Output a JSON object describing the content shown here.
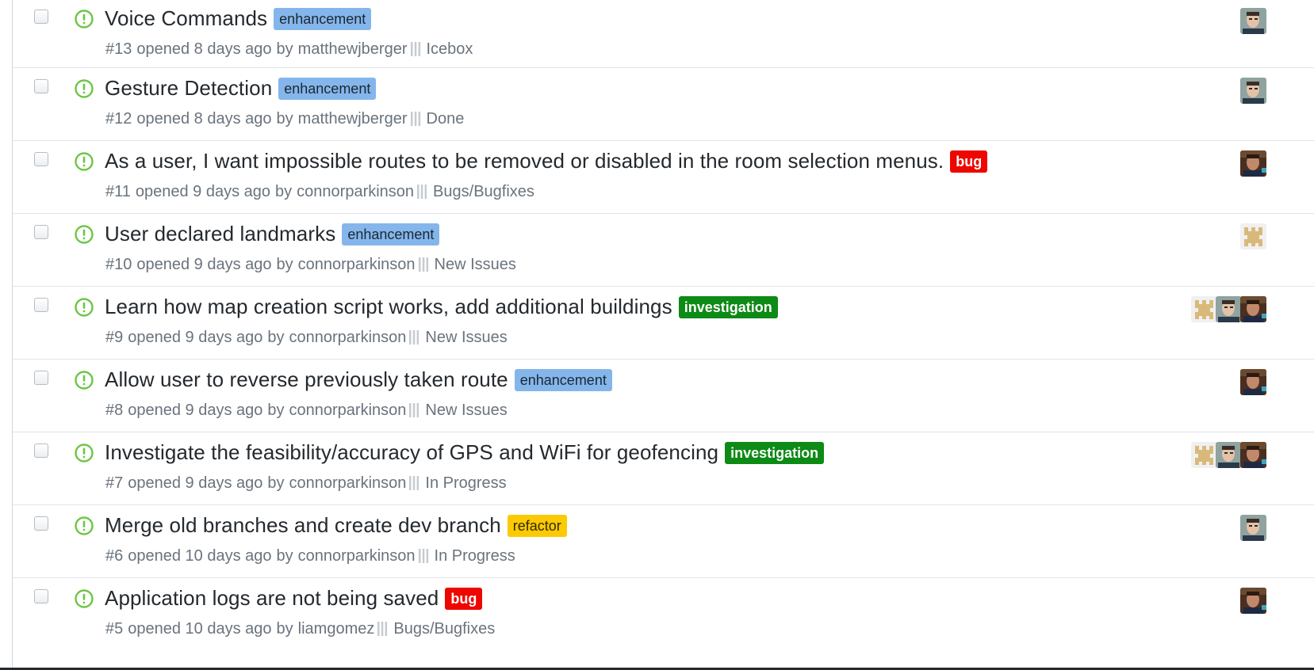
{
  "issues": [
    {
      "title": "Voice Commands",
      "label": {
        "text": "enhancement",
        "kind": "enhancement"
      },
      "number": "#13",
      "opened": "opened 8 days ago",
      "by": "by",
      "author": "matthewjberger",
      "project": "Icebox",
      "avatars": [
        "face-gray"
      ]
    },
    {
      "title": "Gesture Detection",
      "label": {
        "text": "enhancement",
        "kind": "enhancement"
      },
      "number": "#12",
      "opened": "opened 8 days ago",
      "by": "by",
      "author": "matthewjberger",
      "project": "Done",
      "avatars": [
        "face-gray"
      ]
    },
    {
      "title": "As a user, I want impossible routes to be removed or disabled in the room selection menus.",
      "label": {
        "text": "bug",
        "kind": "bug"
      },
      "number": "#11",
      "opened": "opened 9 days ago",
      "by": "by",
      "author": "connorparkinson",
      "project": "Bugs/Bugfixes",
      "avatars": [
        "face-dark"
      ]
    },
    {
      "title": "User declared landmarks",
      "label": {
        "text": "enhancement",
        "kind": "enhancement"
      },
      "number": "#10",
      "opened": "opened 9 days ago",
      "by": "by",
      "author": "connorparkinson",
      "project": "New Issues",
      "avatars": [
        "identicon"
      ]
    },
    {
      "title": "Learn how map creation script works, add additional buildings",
      "label": {
        "text": "investigation",
        "kind": "investigation"
      },
      "number": "#9",
      "opened": "opened 9 days ago",
      "by": "by",
      "author": "connorparkinson",
      "project": "New Issues",
      "avatars": [
        "identicon",
        "face-gray",
        "face-dark"
      ]
    },
    {
      "title": "Allow user to reverse previously taken route",
      "label": {
        "text": "enhancement",
        "kind": "enhancement"
      },
      "number": "#8",
      "opened": "opened 9 days ago",
      "by": "by",
      "author": "connorparkinson",
      "project": "New Issues",
      "avatars": [
        "face-dark"
      ]
    },
    {
      "title": "Investigate the feasibility/accuracy of GPS and WiFi for geofencing",
      "label": {
        "text": "investigation",
        "kind": "investigation"
      },
      "number": "#7",
      "opened": "opened 9 days ago",
      "by": "by",
      "author": "connorparkinson",
      "project": "In Progress",
      "avatars": [
        "identicon",
        "face-gray",
        "face-dark"
      ]
    },
    {
      "title": "Merge old branches and create dev branch",
      "label": {
        "text": "refactor",
        "kind": "refactor"
      },
      "number": "#6",
      "opened": "opened 10 days ago",
      "by": "by",
      "author": "connorparkinson",
      "project": "In Progress",
      "avatars": [
        "face-gray"
      ]
    },
    {
      "title": "Application logs are not being saved",
      "label": {
        "text": "bug",
        "kind": "bug"
      },
      "number": "#5",
      "opened": "opened 10 days ago",
      "by": "by",
      "author": "liamgomez",
      "project": "Bugs/Bugfixes",
      "avatars": [
        "face-dark"
      ]
    }
  ],
  "colors": {
    "open_icon": "#6cc644",
    "enhancement": "#84b6eb",
    "bug": "#ee0701",
    "investigation": "#0e8a16",
    "refactor": "#fbca04"
  },
  "icons": {
    "status": "issue-opened-icon",
    "project": "project-column-icon",
    "checkbox": "checkbox-icon"
  }
}
